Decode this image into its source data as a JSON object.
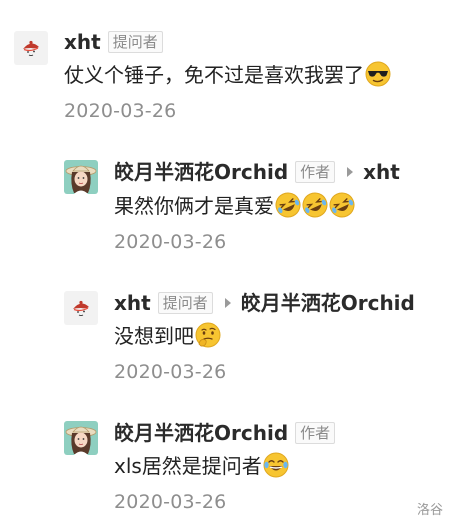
{
  "comments": [
    {
      "user": "xht",
      "badge": "提问者",
      "text": "仗义个锤子，免不过是喜欢我罢了",
      "emojis": [
        "sunglasses-emoji"
      ],
      "date": "2020-03-26"
    },
    {
      "user": "皎月半洒花Orchid",
      "badge": "作者",
      "reply_to": "xht",
      "text": "果然你俩才是真爱",
      "emojis": [
        "rolling-laughing-emoji",
        "rolling-laughing-emoji",
        "rolling-laughing-emoji"
      ],
      "date": "2020-03-26"
    },
    {
      "user": "xht",
      "badge": "提问者",
      "reply_to": "皎月半洒花Orchid",
      "text": "没想到吧",
      "emojis": [
        "thinking-face-emoji"
      ],
      "date": "2020-03-26"
    },
    {
      "user": "皎月半洒花Orchid",
      "badge": "作者",
      "text": "xls居然是提问者",
      "emojis": [
        "crying-laughing-emoji"
      ],
      "date": "2020-03-26"
    }
  ],
  "watermark": "洛谷",
  "colors": {
    "emoji_yellow": "#f7c531",
    "date_gray": "#8e8e8e",
    "badge_border": "#dcdcdc"
  }
}
